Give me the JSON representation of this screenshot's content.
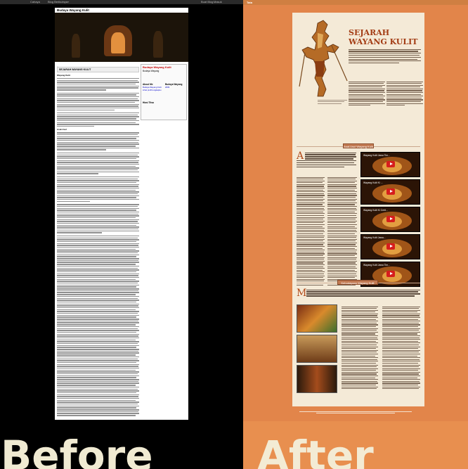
{
  "before": {
    "browser_bar": {
      "left_label": "Cahaya",
      "blog_label": "Blog Berikutnya»",
      "right_links": [
        "Buat Blog",
        "Masuk"
      ]
    },
    "blog_title": "Budaya Wayang Kulit",
    "post_title": "SEJARAH WAYANG KULIT",
    "post_subtitle": "Wayang Kulit",
    "section_heading": "Asal-Usul",
    "sidebar": {
      "title": "Budaya Wayang Kulit",
      "subtitle": "Budaya Wayang",
      "about_heading": "About Me",
      "archive_heading": "Budaya Wayang",
      "archive_year": "2009",
      "footer_heading": "Hiasi Titsa",
      "profile_link": "Lihat profil lengkapku",
      "author": "Budaya Wayang Kulit"
    },
    "bottom_label": "Before"
  },
  "after": {
    "logo": "Tata",
    "title": "SEJARAH WAYANG KULIT",
    "section_button_1": "Asal-Usul Wayang Kulit",
    "section_button_2": "Kebudayaan Wayang Kulit",
    "video_titles": [
      "Wayang Kulit Jawa Tim...",
      "Wayang Kulit Ki ...",
      "Wayang Kulit Ki Cerit...",
      "Wayang Kulit Jawa...",
      "Wayang Kulit Jawa Tim..."
    ],
    "bottom_label": "After"
  },
  "colors": {
    "before_background": "#000000",
    "after_background": "#e2854a",
    "after_title": "#a33c14",
    "label_text": "#f0ead2"
  },
  "icons": [
    "play-icon"
  ]
}
